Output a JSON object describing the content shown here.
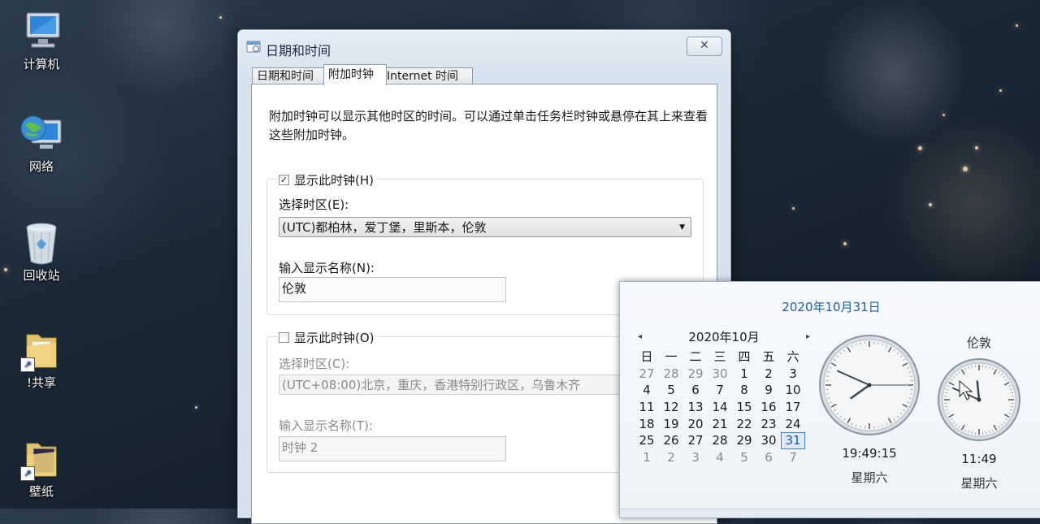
{
  "desktop": {
    "icons": [
      {
        "label": "计算机",
        "icon": "computer-icon"
      },
      {
        "label": "网络",
        "icon": "network-icon"
      },
      {
        "label": "回收站",
        "icon": "recycle-bin-icon"
      },
      {
        "label": "!共享",
        "icon": "folder-shortcut-icon"
      },
      {
        "label": "壁纸",
        "icon": "folder-shortcut-icon"
      }
    ]
  },
  "dialog": {
    "title": "日期和时间",
    "close_glyph": "✕",
    "tabs": [
      {
        "label": "日期和时间"
      },
      {
        "label": "附加时钟"
      },
      {
        "label": "Internet 时间"
      }
    ],
    "active_tab": "附加时钟",
    "description": "附加时钟可以显示其他时区的时间。可以通过单击任务栏时钟或悬停在其上来查看这些附加时钟。",
    "clock1": {
      "checkbox_label": "显示此时钟(H)",
      "checked": true,
      "timezone_label": "选择时区(E):",
      "timezone_value": "(UTC)都柏林，爱丁堡，里斯本，伦敦",
      "name_label": "输入显示名称(N):",
      "name_value": "伦敦"
    },
    "clock2": {
      "checkbox_label": "显示此时钟(O)",
      "checked": false,
      "timezone_label": "选择时区(C):",
      "timezone_value": "(UTC+08:00)北京，重庆，香港特别行政区，乌鲁木齐",
      "name_label": "输入显示名称(T):",
      "name_value": "时钟 2"
    }
  },
  "flyout": {
    "date_link": "2020年10月31日",
    "month_title": "2020年10月",
    "prev_glyph": "◂",
    "next_glyph": "▸",
    "weekdays": [
      "日",
      "一",
      "二",
      "三",
      "四",
      "五",
      "六"
    ],
    "weeks": [
      [
        "27",
        "28",
        "29",
        "30",
        "1",
        "2",
        "3"
      ],
      [
        "4",
        "5",
        "6",
        "7",
        "8",
        "9",
        "10"
      ],
      [
        "11",
        "12",
        "13",
        "14",
        "15",
        "16",
        "17"
      ],
      [
        "18",
        "19",
        "20",
        "21",
        "22",
        "23",
        "24"
      ],
      [
        "25",
        "26",
        "27",
        "28",
        "29",
        "30",
        "31"
      ],
      [
        "1",
        "2",
        "3",
        "4",
        "5",
        "6",
        "7"
      ]
    ],
    "today": "31",
    "local_clock": {
      "time": "19:49:15",
      "day": "星期六",
      "hour": 19,
      "minute": 49,
      "second": 15
    },
    "extra_clock": {
      "title": "伦敦",
      "time": "11:49",
      "day": "星期六",
      "hour": 11,
      "minute": 49
    }
  }
}
